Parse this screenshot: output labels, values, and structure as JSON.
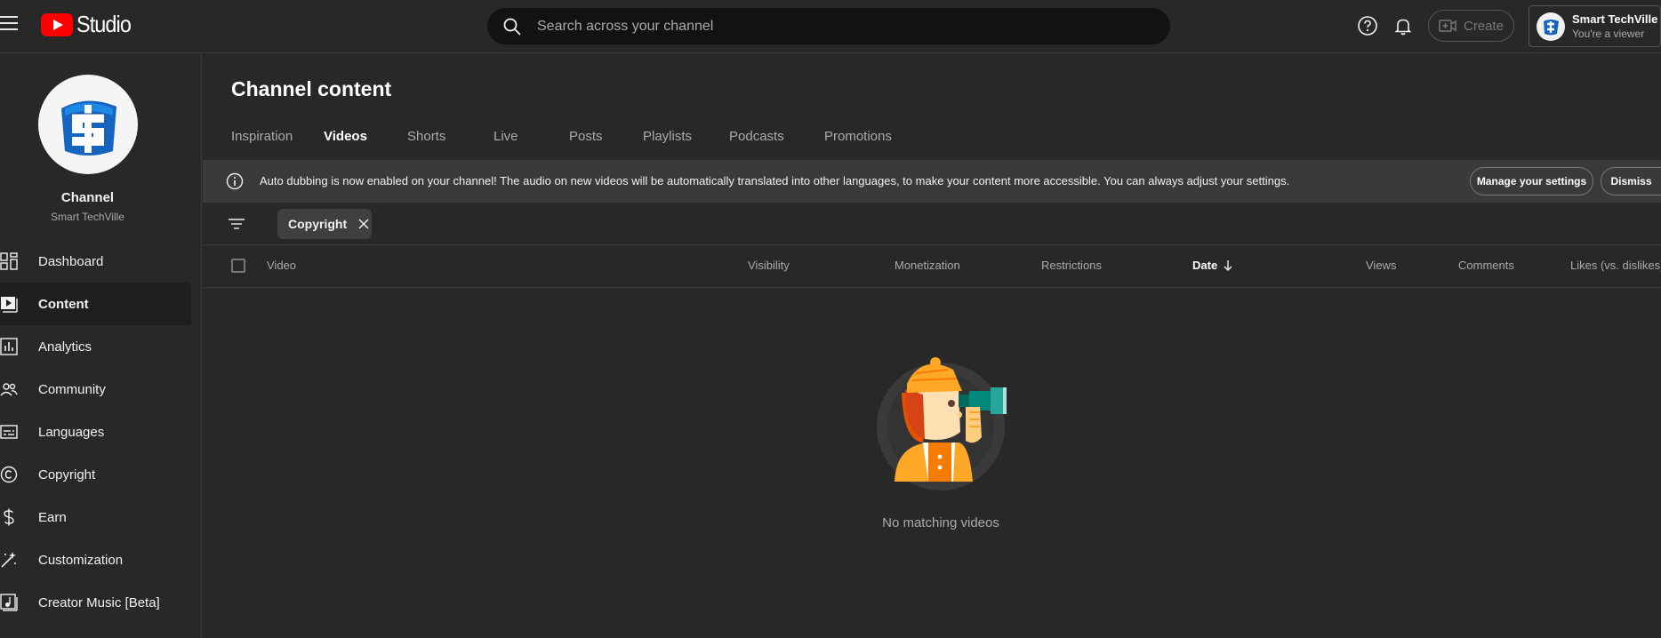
{
  "app": {
    "logo_text": "Studio",
    "search_placeholder": "Search across your channel",
    "create_label": "Create",
    "account": {
      "name": "Smart TechVille",
      "role": "You're a viewer"
    }
  },
  "sidebar": {
    "channel_title": "Channel",
    "channel_name": "Smart TechVille",
    "items": [
      {
        "label": "Dashboard",
        "icon": "dashboard-icon"
      },
      {
        "label": "Content",
        "icon": "content-icon",
        "active": true
      },
      {
        "label": "Analytics",
        "icon": "analytics-icon"
      },
      {
        "label": "Community",
        "icon": "community-icon"
      },
      {
        "label": "Languages",
        "icon": "languages-icon"
      },
      {
        "label": "Copyright",
        "icon": "copyright-icon"
      },
      {
        "label": "Earn",
        "icon": "earn-icon"
      },
      {
        "label": "Customization",
        "icon": "customization-icon"
      },
      {
        "label": "Creator Music [Beta]",
        "icon": "music-icon"
      }
    ]
  },
  "main": {
    "title": "Channel content",
    "tabs": [
      {
        "label": "Inspiration"
      },
      {
        "label": "Videos",
        "active": true
      },
      {
        "label": "Shorts"
      },
      {
        "label": "Live"
      },
      {
        "label": "Posts"
      },
      {
        "label": "Playlists"
      },
      {
        "label": "Podcasts"
      },
      {
        "label": "Promotions"
      }
    ],
    "banner": {
      "text": "Auto dubbing is now enabled on your channel! The audio on new videos will be automatically translated into other languages, to make your content more accessible. You can always adjust your settings.",
      "manage_label": "Manage your settings",
      "dismiss_label": "Dismiss"
    },
    "filter_chip": "Copyright",
    "columns": {
      "video": "Video",
      "visibility": "Visibility",
      "monetization": "Monetization",
      "restrictions": "Restrictions",
      "date": "Date",
      "views": "Views",
      "comments": "Comments",
      "likes": "Likes (vs. dislikes)"
    },
    "empty_text": "No matching videos"
  },
  "colors": {
    "background": "#282828",
    "brand_red": "#ff0000",
    "logo_blue": "#1565c0",
    "illustration_orange": "#f57c00",
    "illustration_teal": "#00897b"
  }
}
